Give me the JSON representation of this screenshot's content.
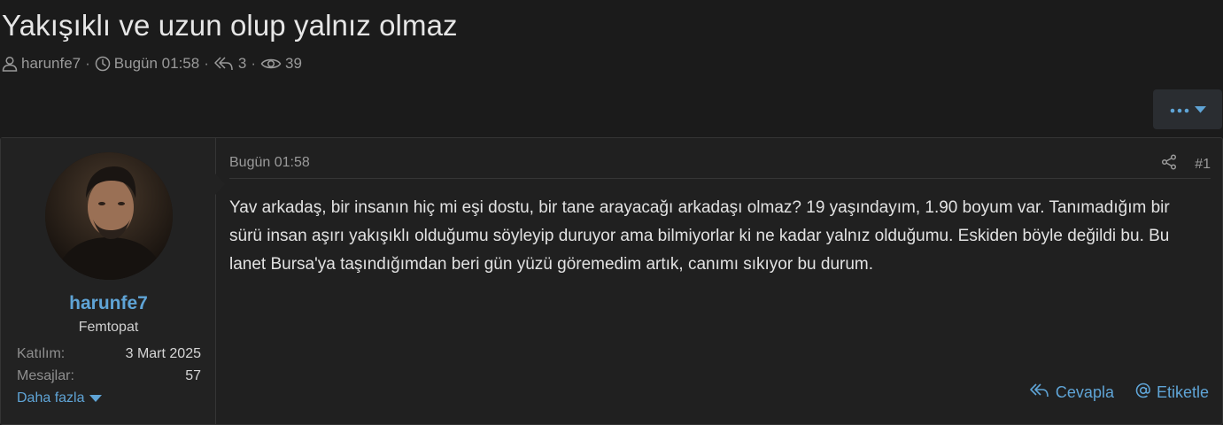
{
  "thread": {
    "title": "Yakışıklı ve uzun olup yalnız olmaz",
    "author": "harunfe7",
    "date": "Bugün 01:58",
    "replies": "3",
    "views": "39"
  },
  "post": {
    "date": "Bugün 01:58",
    "number": "#1",
    "body": "Yav arkadaş, bir insanın hiç mi eşi dostu, bir tane arayacağı arkadaşı olmaz? 19 yaşındayım, 1.90 boyum var. Tanımadığım bir sürü insan aşırı yakışıklı olduğumu söyleyip duruyor ama bilmiyorlar ki ne kadar yalnız olduğumu. Eskiden böyle değildi bu. Bu lanet Bursa'ya taşındığımdan beri gün yüzü göremedim artık, canımı sıkıyor bu durum.",
    "reply_label": "Cevapla",
    "mention_label": "Etiketle"
  },
  "user": {
    "name": "harunfe7",
    "title": "Femtopat",
    "joined_label": "Katılım:",
    "joined_value": "3 Mart 2025",
    "messages_label": "Mesajlar:",
    "messages_value": "57",
    "more_label": "Daha fazla"
  },
  "colors": {
    "background": "#1b1b1b",
    "panel": "#202020",
    "accent": "#5fa4d6",
    "muted": "#9a9a9a"
  },
  "icons": [
    "user-icon",
    "clock-icon",
    "reply-icon",
    "eye-icon",
    "more-dots-icon",
    "caret-down-icon",
    "share-icon",
    "at-icon"
  ]
}
